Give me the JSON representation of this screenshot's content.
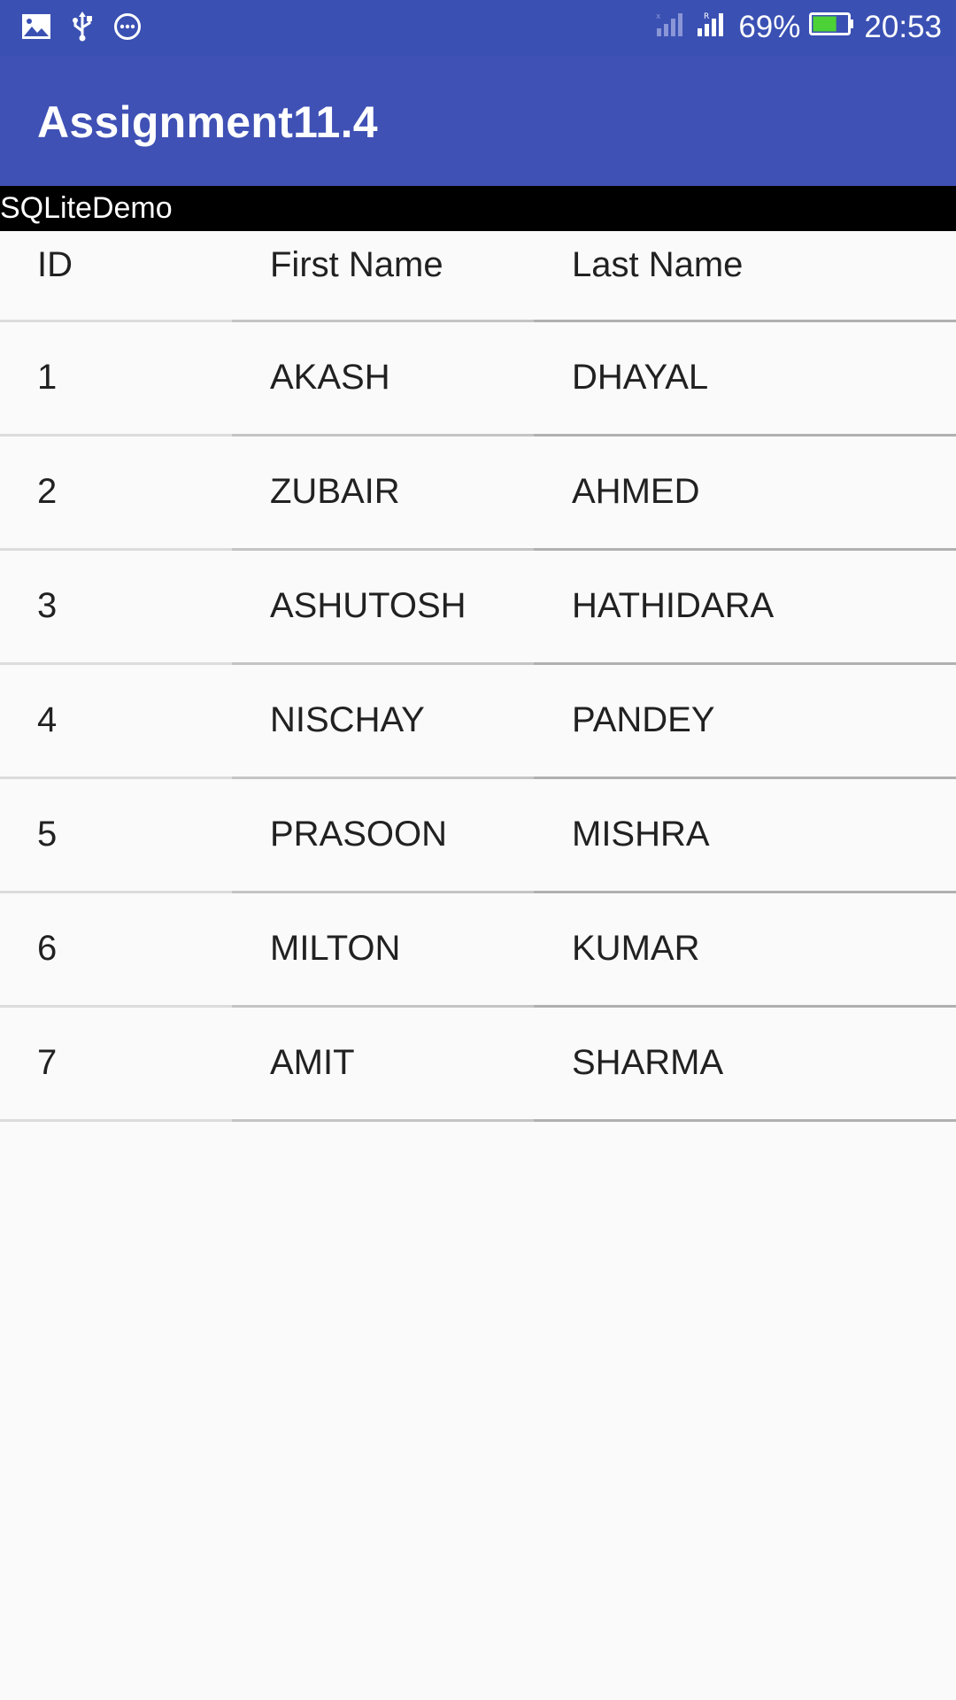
{
  "status_bar": {
    "icons_left": [
      "image-icon",
      "usb-icon",
      "more-icon"
    ],
    "icons_right": [
      "signal-icon",
      "signal-roaming-icon",
      "battery-icon"
    ],
    "battery_percent": "69%",
    "battery_level": 0.69,
    "time": "20:53",
    "colors": {
      "background": "#3a50b3",
      "battery_fill": "#4cd137"
    }
  },
  "app_bar": {
    "title": "Assignment11.4",
    "background": "#3f51b5"
  },
  "section_label": "SQLiteDemo",
  "table": {
    "headers": {
      "id": "ID",
      "first_name": "First Name",
      "last_name": "Last Name"
    },
    "rows": [
      {
        "id": "1",
        "first_name": "AKASH",
        "last_name": "DHAYAL"
      },
      {
        "id": "2",
        "first_name": "ZUBAIR",
        "last_name": "AHMED"
      },
      {
        "id": "3",
        "first_name": "ASHUTOSH",
        "last_name": "HATHIDARA"
      },
      {
        "id": "4",
        "first_name": "NISCHAY",
        "last_name": "PANDEY"
      },
      {
        "id": "5",
        "first_name": "PRASOON",
        "last_name": "MISHRA"
      },
      {
        "id": "6",
        "first_name": "MILTON",
        "last_name": "KUMAR"
      },
      {
        "id": "7",
        "first_name": "AMIT",
        "last_name": "SHARMA"
      }
    ]
  }
}
